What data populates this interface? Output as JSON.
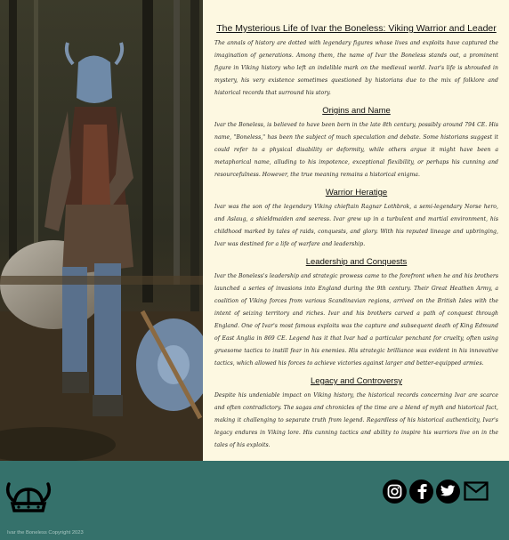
{
  "article": {
    "title": "The Mysterious Life of Ivar the Boneless: Viking Warrior and Leader",
    "intro": "The annals of history are dotted with legendary figures whose lives and exploits have captured the imagination of generations. Among them, the name of Ivar the Boneless stands out, a prominent figure in Viking history who left an indelible mark on the medieval world. Ivar's life is shrouded in mystery, his very existence sometimes questioned by historians due to the mix of folklore and historical records that surround his story.",
    "sections": [
      {
        "heading": "Origins and Name",
        "body": "Ivar the Boneless, is believed to have been born in the late 8th century, possibly around 794 CE. His name, \"Boneless,\" has been the subject of much speculation and debate. Some historians suggest it could refer to a physical disability or deformity, while others argue it might have been a metaphorical name, alluding to his impotence, exceptional flexibility, or perhaps his cunning and resourcefulness. However, the true meaning remains a historical enigma."
      },
      {
        "heading": "Warrior Heratige",
        "body": "Ivar was the son of the legendary Viking chieftain Ragnar Lothbrok, a semi-legendary Norse hero, and Aslaug, a shieldmaiden and seeress. Ivar grew up in a turbulent and martial environment, his childhood marked by tales of raids, conquests, and glory. With his reputed lineage and upbringing, Ivar was destined for a life of warfare and leadership."
      },
      {
        "heading": "Leadership and Conquests",
        "body": "Ivar the Boneless's leadership and strategic prowess came to the forefront when he and his brothers launched a series of invasions into England during the 9th century. Their Great Heathen Army, a coalition of Viking forces from various Scandinavian regions, arrived on the British Isles with the intent of seizing territory and riches. Ivar and his brothers carved a path of conquest through England. One of Ivar's most famous exploits was the capture and subsequent death of King Edmund of East Anglia in 869 CE. Legend has it that Ivar had a particular penchant for cruelty, often using gruesome tactics to instill fear in his enemies. His strategic brilliance was evident in his innovative tactics, which allowed his forces to achieve victories against larger and better-equipped armies."
      },
      {
        "heading": "Legacy and Controversy",
        "body": "Despite his undeniable impact on Viking history, the historical records concerning Ivar are scarce and often contradictory. The sagas and chronicles of the time are a blend of myth and historical fact, making it challenging to separate truth from legend. Regardless of his historical authenticity, Ivar's legacy endures in Viking lore. His cunning tactics and ability to inspire his warriors live on in the tales of his exploits."
      }
    ]
  },
  "footer": {
    "copyright": "Ivar the Boneless Copyright 2023",
    "social_icons": [
      "instagram-icon",
      "facebook-icon",
      "twitter-icon",
      "mail-icon"
    ],
    "background_color": "#35716b"
  },
  "colors": {
    "content_background": "#fdf8e1"
  }
}
